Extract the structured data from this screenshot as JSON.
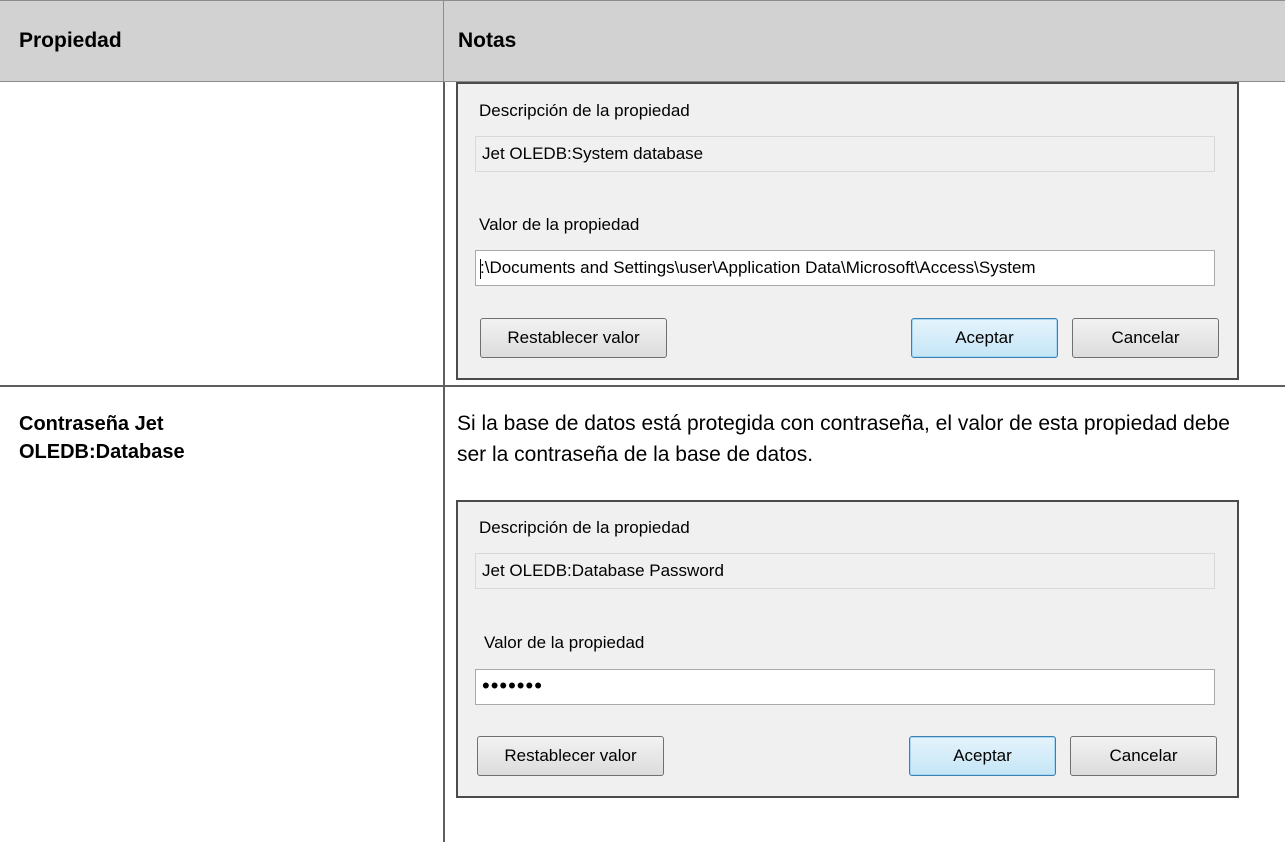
{
  "table": {
    "header": {
      "col1": "Propiedad",
      "col2": "Notas"
    },
    "row2": {
      "property": "Contraseña Jet OLEDB:Database",
      "notes": "Si la base de datos está protegida con contraseña, el valor de esta propiedad debe ser la contraseña de la base de datos."
    }
  },
  "dialog1": {
    "desc_label": "Descripción de la propiedad",
    "desc_value": "Jet OLEDB:System database",
    "value_label": "Valor de la propiedad",
    "value": ":\\Documents and Settings\\user\\Application Data\\Microsoft\\Access\\System",
    "reset": "Restablecer valor",
    "ok": "Aceptar",
    "cancel": "Cancelar"
  },
  "dialog2": {
    "desc_label": "Descripción de la propiedad",
    "desc_value": "Jet OLEDB:Database Password",
    "value_label": "Valor de la propiedad",
    "value": "•••••••",
    "reset": "Restablecer valor",
    "ok": "Aceptar",
    "cancel": "Cancelar"
  }
}
